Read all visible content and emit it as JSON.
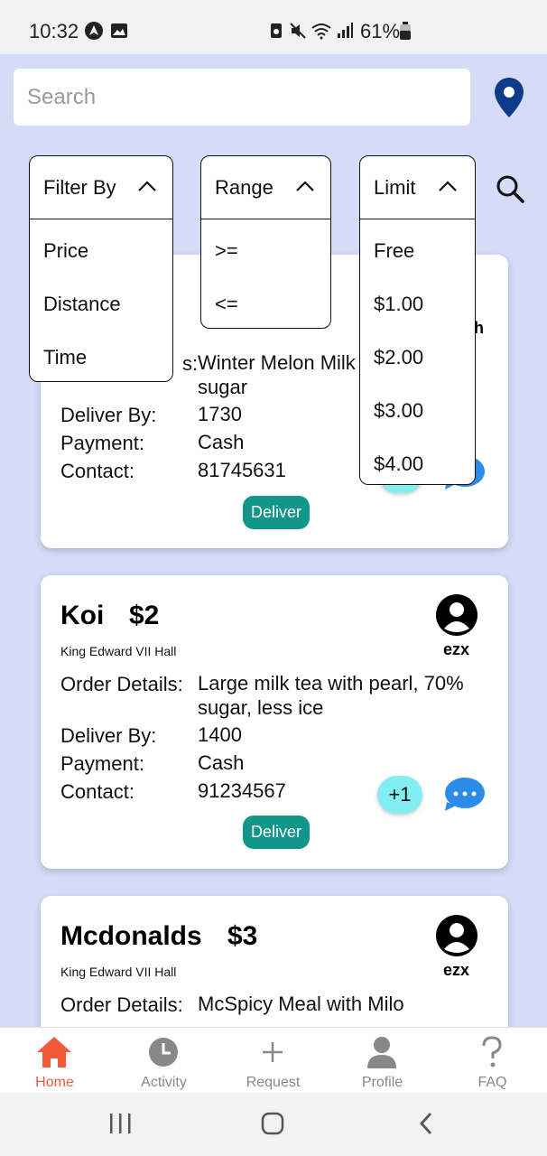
{
  "status_bar": {
    "time": "10:32",
    "battery": "61%"
  },
  "search": {
    "placeholder": "Search"
  },
  "dropdowns": {
    "filter": {
      "title": "Filter By",
      "options": [
        "Price",
        "Distance",
        "Time"
      ]
    },
    "range": {
      "title": "Range",
      "options": [
        ">=",
        "<="
      ]
    },
    "limit": {
      "title": "Limit",
      "options": [
        "Free",
        "$1.00",
        "$2.00",
        "$3.00",
        "$4.00"
      ]
    }
  },
  "cards": [
    {
      "name": "",
      "price": "",
      "location": "",
      "user": "",
      "partial_user": "h",
      "labels": {
        "details_tail": "s:",
        "deliver_by": "Deliver By:",
        "payment": "Payment:",
        "contact": "Contact:"
      },
      "order_details": "Winter Melon Milk with brown sugar",
      "deliver_by": "1730",
      "payment": "Cash",
      "contact": "81745631",
      "deliver_label": "Deliver"
    },
    {
      "name": "Koi",
      "price": "$2",
      "location": "King Edward VII Hall",
      "user": "ezx",
      "labels": {
        "details": "Order Details:",
        "deliver_by": "Deliver By:",
        "payment": "Payment:",
        "contact": "Contact:"
      },
      "order_details": "Large milk tea with pearl, 70% sugar, less ice",
      "deliver_by": "1400",
      "payment": "Cash",
      "contact": "91234567",
      "join_label": "+1",
      "deliver_label": "Deliver"
    },
    {
      "name": "Mcdonalds",
      "price": "$3",
      "location": "King Edward VII Hall",
      "user": "ezx",
      "labels": {
        "details": "Order Details:"
      },
      "order_details": "McSpicy Meal with Milo"
    }
  ],
  "bottom_nav": [
    {
      "label": "Home",
      "icon": "home-icon",
      "active": true
    },
    {
      "label": "Activity",
      "icon": "clock-icon",
      "active": false
    },
    {
      "label": "Request",
      "icon": "plus-icon",
      "active": false
    },
    {
      "label": "Profile",
      "icon": "person-icon",
      "active": false
    },
    {
      "label": "FAQ",
      "icon": "question-icon",
      "active": false
    }
  ],
  "colors": {
    "background": "#d6dcf8",
    "accent": "#f05a3a",
    "deliver": "#12968a",
    "join": "#82eef0",
    "chat": "#2b8be8"
  }
}
